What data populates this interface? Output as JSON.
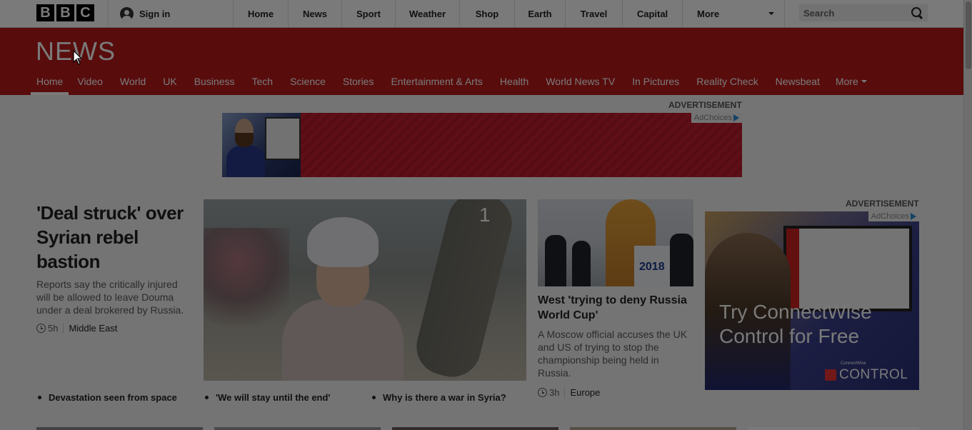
{
  "bbc_logo": [
    "B",
    "B",
    "C"
  ],
  "topbar": {
    "signin_label": "Sign in",
    "nav": [
      {
        "label": "Home"
      },
      {
        "label": "News"
      },
      {
        "label": "Sport"
      },
      {
        "label": "Weather"
      },
      {
        "label": "Shop"
      },
      {
        "label": "Earth"
      },
      {
        "label": "Travel"
      },
      {
        "label": "Capital"
      }
    ],
    "more_label": "More",
    "search_placeholder": "Search"
  },
  "news": {
    "logo": "NEWS",
    "nav": [
      {
        "label": "Home",
        "active": true
      },
      {
        "label": "Video"
      },
      {
        "label": "World"
      },
      {
        "label": "UK"
      },
      {
        "label": "Business"
      },
      {
        "label": "Tech"
      },
      {
        "label": "Science"
      },
      {
        "label": "Stories"
      },
      {
        "label": "Entertainment & Arts"
      },
      {
        "label": "Health"
      },
      {
        "label": "World News TV"
      },
      {
        "label": "In Pictures"
      },
      {
        "label": "Reality Check"
      },
      {
        "label": "Newsbeat"
      }
    ],
    "more_label": "More"
  },
  "ads": {
    "label": "ADVERTISEMENT",
    "adchoices": "AdChoices",
    "ad2_cta": "Try ConnectWise Control for Free",
    "ad2_brand": "CONTROL",
    "ad2_brand_small": "ConnectWise"
  },
  "lead": {
    "title": "'Deal struck' over Syrian rebel bastion",
    "summary": "Reports say the critically injured will be allowed to leave Douma under a deal brokered by Russia.",
    "time": "5h",
    "section": "Middle East",
    "image_counter": "1"
  },
  "story2": {
    "title": "West 'trying to deny Russia World Cup'",
    "summary": "A Moscow official accuses the UK and US of trying to stop the championship being held in Russia.",
    "time": "3h",
    "section": "Europe",
    "image_text": "2018"
  },
  "related": [
    "Devastation seen from space",
    "'We will stay until the end'",
    "Why is there a war in Syria?"
  ],
  "colors": {
    "news_red": "#bb1919",
    "overlay": "rgba(0,0,0,0.52)"
  }
}
